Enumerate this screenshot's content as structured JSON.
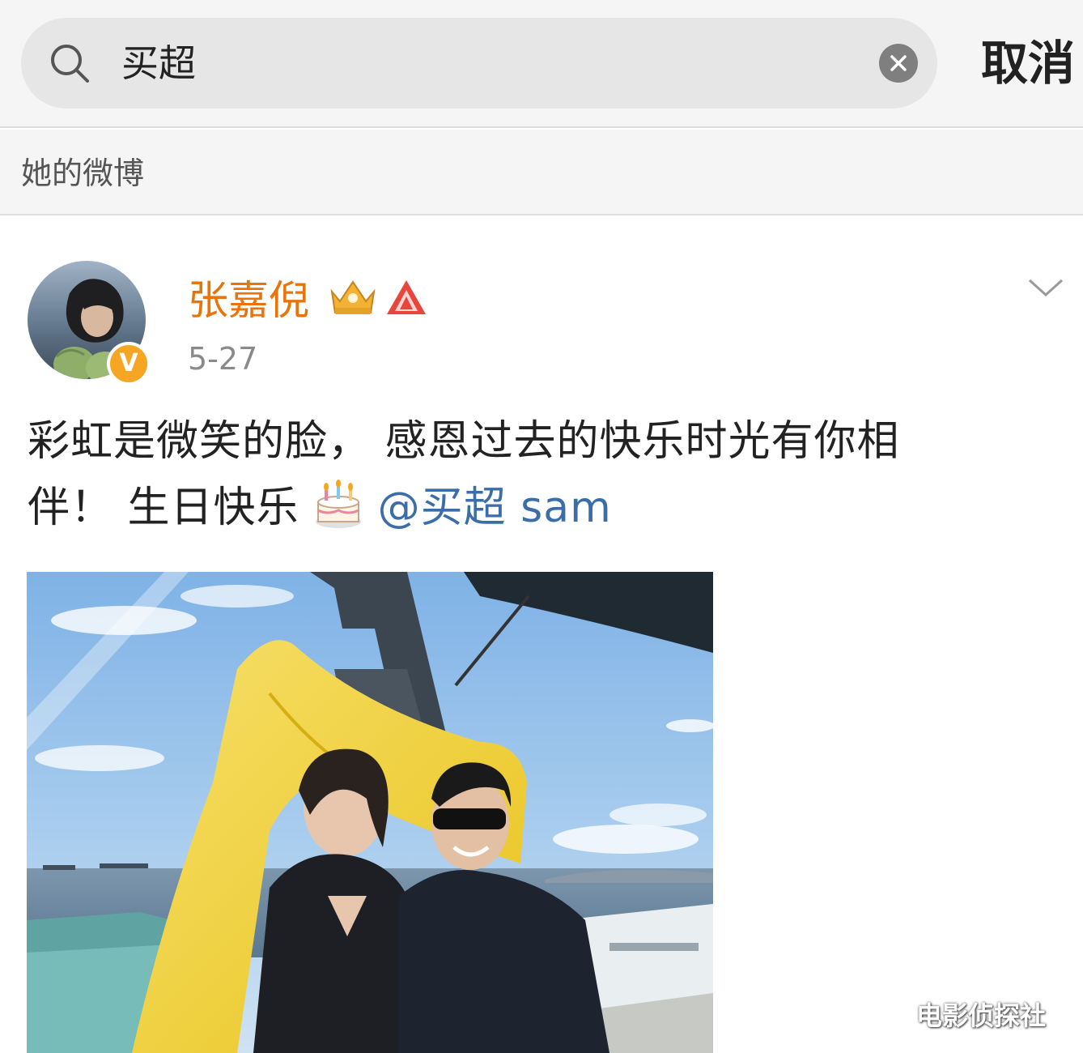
{
  "search": {
    "query": "买超",
    "cancel_label": "取消"
  },
  "section": {
    "title": "她的微博"
  },
  "post": {
    "author": "张嘉倪",
    "verified_mark": "V",
    "date": "5-27",
    "text_main": "彩虹是微笑的脸， 感恩过去的快乐时光有你相伴！ 生日快乐",
    "mention": "@买超 sam",
    "emoji": "birthday-cake-icon"
  },
  "watermark": "电影侦探社",
  "colors": {
    "username": "#e8740c",
    "mention": "#3b6ea8",
    "verified": "#f6a623",
    "search_bg": "#e6e6e6"
  }
}
